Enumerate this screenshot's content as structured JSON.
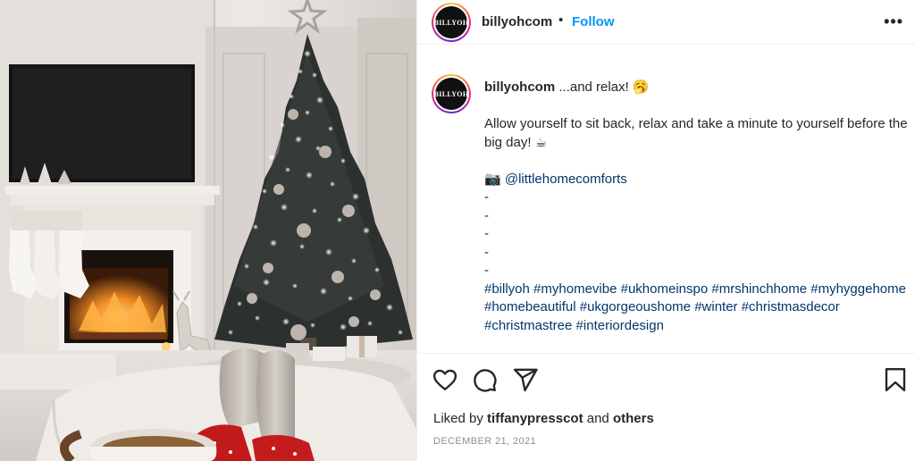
{
  "post": {
    "username": "billyohcom",
    "avatar_text": "BILLYOH",
    "separator": "•",
    "follow_label": "Follow",
    "more_label": "•••"
  },
  "caption": {
    "username": "billyohcom",
    "first_line": "...and relax! 🥱",
    "line2": "Allow yourself to sit back, relax and take a minute to yourself before the big day! ☕",
    "camera_emoji": "📷",
    "mention": "@littlehomecomforts",
    "dashes": [
      "-",
      "-",
      "-",
      "-",
      "-"
    ],
    "hashtags": [
      "#billyoh",
      "#myhomevibe",
      "#ukhomeinspo",
      "#mrshinchhome",
      "#myhyggehome",
      "#homebeautiful",
      "#ukgorgeoushome",
      "#winter",
      "#christmasdecor",
      "#christmastree",
      "#interiordesign"
    ]
  },
  "actions": {
    "like_icon": "heart-icon",
    "comment_icon": "comment-icon",
    "share_icon": "paper-plane-icon",
    "save_icon": "bookmark-icon"
  },
  "likes": {
    "prefix": "Liked by ",
    "user": "tiffanypresscot",
    "middle": " and ",
    "others": "others"
  },
  "date": "DECEMBER 21, 2021",
  "colors": {
    "link": "#00376b",
    "follow": "#0095f6",
    "muted": "#8e8e8e"
  }
}
